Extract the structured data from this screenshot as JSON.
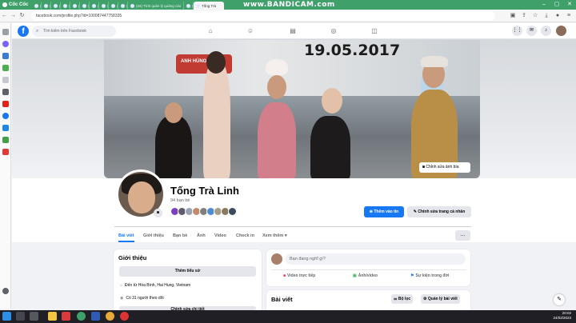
{
  "browser": {
    "logo": "Cốc Cốc",
    "tabs": [
      "(N)",
      "(N)",
      "(N)",
      "(N)",
      "(N)",
      "(N)",
      "(N)",
      "(N)",
      "(N)",
      "(N)",
      "(34) Tình quản lý quảng cáo",
      "(N)",
      "Tống Trà"
    ],
    "recorder": "www.BANDICAM.com",
    "url": "facebook.com/profile.php?id=100087447758335"
  },
  "fb": {
    "search_placeholder": "Tìm kiếm trên Facebook"
  },
  "cover": {
    "date_text": "19.05.2017",
    "banner_text": "ANH HÙNG",
    "edit_label": "Chỉnh sửa ảnh bìa"
  },
  "profile": {
    "name": "Tống Trà Linh",
    "friends": "94 bạn bè",
    "add_story": "Thêm vào tin",
    "edit_profile": "Chỉnh sửa trang cá nhân",
    "tabs": [
      "Bài viết",
      "Giới thiệu",
      "Bạn bè",
      "Ảnh",
      "Video",
      "Check in",
      "Xem thêm"
    ]
  },
  "intro": {
    "title": "Giới thiệu",
    "add_bio": "Thêm tiểu sử",
    "from": "Đến từ Hòa Bình, Hai Hung, Vietnam",
    "followers": "Có 31 người theo dõi",
    "edit_details": "Chỉnh sửa chi tiết"
  },
  "composer": {
    "placeholder": "Bạn đang nghĩ gì?",
    "live": "Video trực tiếp",
    "photo": "Ảnh/video",
    "event": "Sự kiện trong đời"
  },
  "posts": {
    "title": "Bài viết",
    "filter": "Bộ lọc",
    "manage": "Quản lý bài viết"
  },
  "taskbar": {
    "time": "20:02",
    "date": "24/02/2023"
  },
  "colors": {
    "fb_blue": "#1877f2",
    "browser_green": "#3fa06a"
  }
}
